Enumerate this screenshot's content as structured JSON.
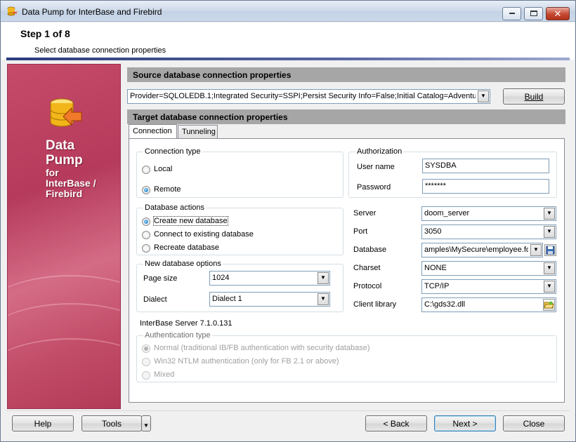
{
  "window": {
    "title": "Data Pump for InterBase and Firebird"
  },
  "header": {
    "step": "Step 1 of 8",
    "description": "Select database connection properties"
  },
  "banner": {
    "line1": "Data",
    "line2": "Pump",
    "line3": "for",
    "line4": "InterBase /",
    "line5": "Firebird"
  },
  "source": {
    "title": "Source database connection properties",
    "connection_string": "Provider=SQLOLEDB.1;Integrated Security=SSPI;Persist Security Info=False;Initial Catalog=AdventureWo",
    "build_label": "Build"
  },
  "target": {
    "title": "Target database connection properties",
    "tabs": [
      {
        "label": "Connection"
      },
      {
        "label": "Tunneling"
      }
    ],
    "connection_type": {
      "legend": "Connection type",
      "local": "Local",
      "remote": "Remote",
      "selected": "remote"
    },
    "authorization": {
      "legend": "Authorization",
      "user_label": "User name",
      "user_value": "SYSDBA",
      "password_label": "Password",
      "password_value": "*******"
    },
    "db_actions": {
      "legend": "Database actions",
      "create": "Create new database",
      "connect": "Connect to existing database",
      "recreate": "Recreate database",
      "selected": "create"
    },
    "new_db_options": {
      "legend": "New database options",
      "page_size_label": "Page size",
      "page_size": "1024",
      "dialect_label": "Dialect",
      "dialect": "Dialect 1"
    },
    "server_label": "Server",
    "server": "doom_server",
    "port_label": "Port",
    "port": "3050",
    "database_label": "Database",
    "database": "amples\\MySecure\\employee.fdb",
    "charset_label": "Charset",
    "charset": "NONE",
    "protocol_label": "Protocol",
    "protocol": "TCP/IP",
    "client_library_label": "Client library",
    "client_library": "C:\\gds32.dll",
    "server_version": "InterBase Server 7.1.0.131",
    "auth_type": {
      "legend": "Authentication type",
      "normal": "Normal (traditional IB/FB authentication with security database)",
      "ntlm": "Win32 NTLM authentication (only for FB 2.1 or above)",
      "mixed": "Mixed"
    }
  },
  "footer": {
    "help": "Help",
    "tools": "Tools",
    "back": "< Back",
    "next": "Next >",
    "close": "Close"
  }
}
